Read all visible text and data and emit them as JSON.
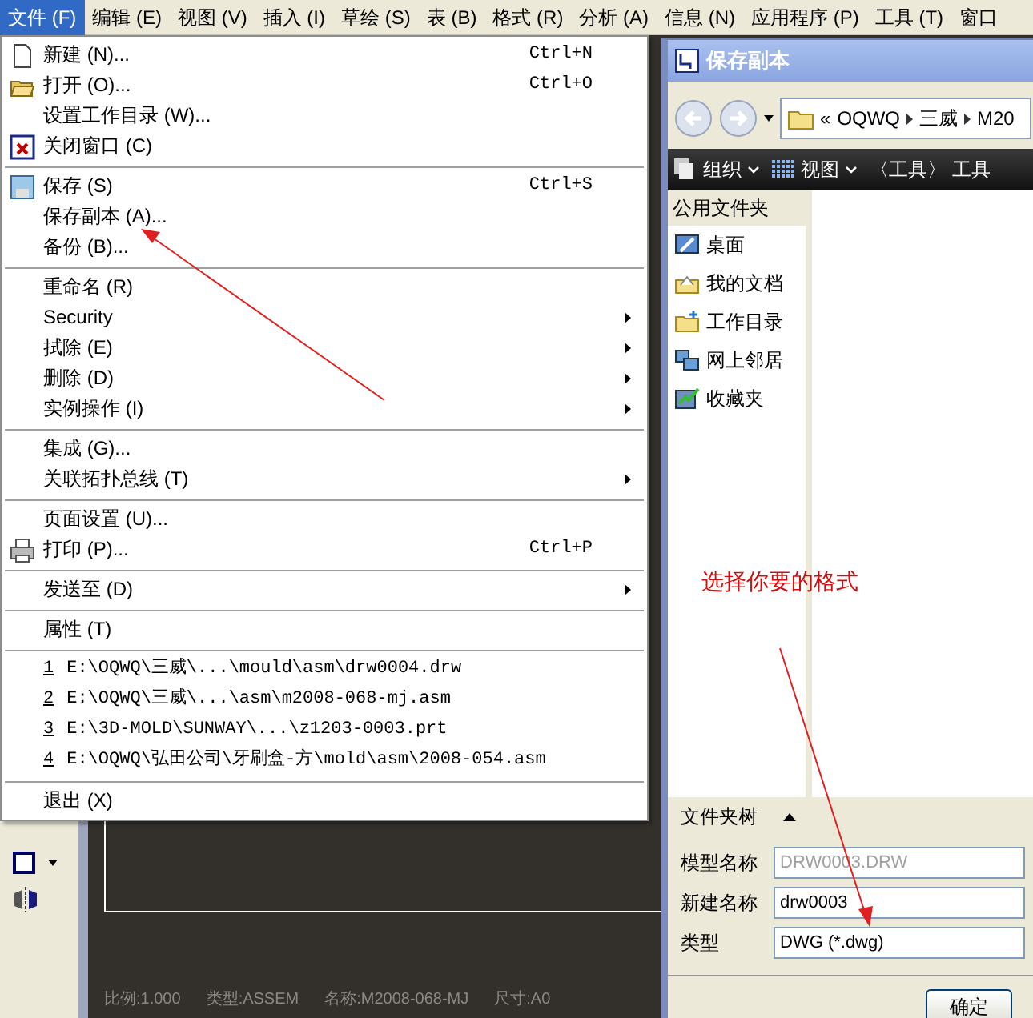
{
  "menu_bar": [
    {
      "label": "文件 (F)",
      "selected": true
    },
    {
      "label": "编辑 (E)",
      "selected": false
    },
    {
      "label": "视图 (V)",
      "selected": false
    },
    {
      "label": "插入 (I)",
      "selected": false
    },
    {
      "label": "草绘 (S)",
      "selected": false
    },
    {
      "label": "表 (B)",
      "selected": false
    },
    {
      "label": "格式 (R)",
      "selected": false
    },
    {
      "label": "分析 (A)",
      "selected": false
    },
    {
      "label": "信息 (N)",
      "selected": false
    },
    {
      "label": "应用程序 (P)",
      "selected": false
    },
    {
      "label": "工具 (T)",
      "selected": false
    },
    {
      "label": "窗口",
      "selected": false
    }
  ],
  "file_menu": [
    {
      "kind": "item",
      "label": "新建 (N)...",
      "shortcut": "Ctrl+N",
      "has_submenu": false
    },
    {
      "kind": "item",
      "label": "打开 (O)...",
      "shortcut": "Ctrl+O",
      "has_submenu": false
    },
    {
      "kind": "item",
      "label": "设置工作目录 (W)...",
      "has_submenu": false
    },
    {
      "kind": "item",
      "label": "关闭窗口 (C)",
      "has_submenu": false
    },
    {
      "kind": "separator"
    },
    {
      "kind": "item",
      "label": "保存 (S)",
      "shortcut": "Ctrl+S",
      "has_submenu": false
    },
    {
      "kind": "item",
      "label": "保存副本 (A)...",
      "has_submenu": false
    },
    {
      "kind": "item",
      "label": "备份 (B)...",
      "has_submenu": false
    },
    {
      "kind": "separator"
    },
    {
      "kind": "item",
      "label": "重命名 (R)",
      "has_submenu": false
    },
    {
      "kind": "item",
      "label": "Security",
      "has_submenu": true
    },
    {
      "kind": "item",
      "label": "拭除 (E)",
      "has_submenu": true
    },
    {
      "kind": "item",
      "label": "删除 (D)",
      "has_submenu": true
    },
    {
      "kind": "item",
      "label": "实例操作 (I)",
      "has_submenu": true
    },
    {
      "kind": "separator"
    },
    {
      "kind": "item",
      "label": "集成 (G)...",
      "has_submenu": false
    },
    {
      "kind": "item",
      "label": "关联拓扑总线 (T)",
      "has_submenu": true
    },
    {
      "kind": "separator"
    },
    {
      "kind": "item",
      "label": "页面设置 (U)...",
      "has_submenu": false
    },
    {
      "kind": "item",
      "label": "打印 (P)...",
      "shortcut": "Ctrl+P",
      "has_submenu": false
    },
    {
      "kind": "separator"
    },
    {
      "kind": "item",
      "label": "发送至 (D)",
      "has_submenu": true
    },
    {
      "kind": "separator"
    },
    {
      "kind": "item",
      "label": "属性 (T)",
      "has_submenu": false
    },
    {
      "kind": "separator"
    },
    {
      "kind": "recent",
      "number": "1",
      "path": "E:\\OQWQ\\三威\\...\\mould\\asm\\drw0004.drw"
    },
    {
      "kind": "recent",
      "number": "2",
      "path": "E:\\OQWQ\\三威\\...\\asm\\m2008-068-mj.asm"
    },
    {
      "kind": "recent",
      "number": "3",
      "path": "E:\\3D-MOLD\\SUNWAY\\...\\z1203-0003.prt"
    },
    {
      "kind": "recent",
      "number": "4",
      "path": "E:\\OQWQ\\弘田公司\\牙刷盒-方\\mold\\asm\\2008-054.asm"
    },
    {
      "kind": "separator"
    },
    {
      "kind": "item",
      "label": "退出 (X)",
      "has_submenu": false
    }
  ],
  "drawing_status": [
    "比例:1.000",
    "类型:ASSEM",
    "名称:M2008-068-MJ",
    "尺寸:A0"
  ],
  "dialog": {
    "title": "保存副本",
    "breadcrumb_prefix": "«",
    "breadcrumb": [
      "OQWQ",
      "三威",
      "M20"
    ],
    "toolbar": [
      "组织",
      "视图",
      "〈工具〉 工具"
    ],
    "sidebar_header": "公用文件夹",
    "sidebar_items": [
      "桌面",
      "我的文档",
      "工作目录",
      "网上邻居",
      "收藏夹"
    ],
    "folder_tree": "文件夹树",
    "fields": [
      {
        "label": "模型名称",
        "value": "DRW0003.DRW",
        "disabled": true
      },
      {
        "label": "新建名称",
        "value": "drw0003",
        "disabled": false
      },
      {
        "label": "类型",
        "value": "DWG (*.dwg)",
        "disabled": false
      }
    ],
    "ok_button": "确定"
  },
  "annotation": {
    "text": "选择你要的格式"
  }
}
